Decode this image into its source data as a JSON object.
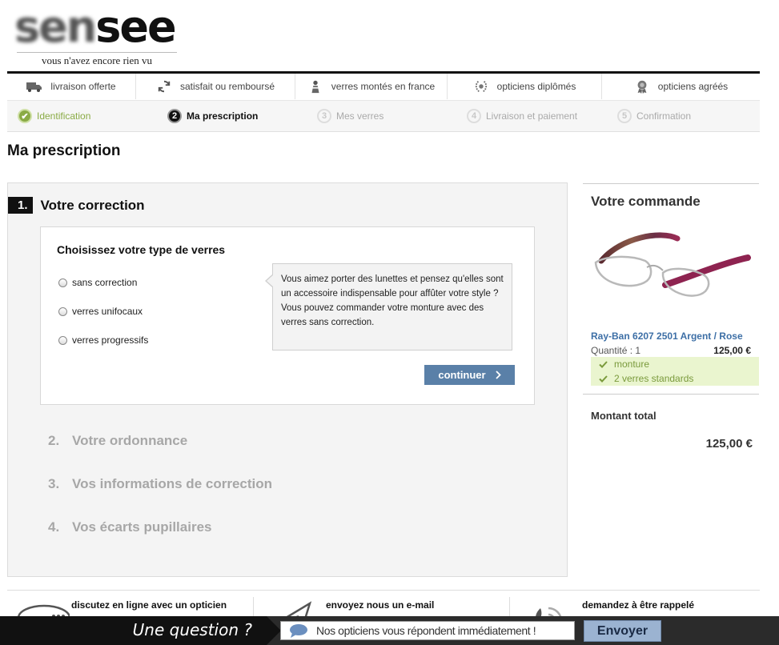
{
  "header": {
    "logo_prefix": "sen",
    "logo_suffix": "see",
    "tagline": "vous n'avez encore rien vu"
  },
  "benefits": [
    {
      "label": "livraison offerte",
      "icon": "truck-icon"
    },
    {
      "label": "satisfait ou remboursé",
      "icon": "refresh-icon"
    },
    {
      "label": "verres montés en france",
      "icon": "worker-icon"
    },
    {
      "label": "opticiens diplômés",
      "icon": "laurel-icon"
    },
    {
      "label": "opticiens agréés",
      "icon": "medal-icon"
    }
  ],
  "steps": [
    {
      "num": "✔",
      "label": "Identification",
      "state": "done"
    },
    {
      "num": "2",
      "label": "Ma prescription",
      "state": "active"
    },
    {
      "num": "3",
      "label": "Mes verres",
      "state": "todo"
    },
    {
      "num": "4",
      "label": "Livraison et paiement",
      "state": "todo"
    },
    {
      "num": "5",
      "label": "Confirmation",
      "state": "todo"
    }
  ],
  "page_title": "Ma prescription",
  "section1": {
    "num": "1.",
    "title": "Votre correction",
    "box_title": "Choisissez votre type de verres",
    "options": [
      "sans correction",
      "verres unifocaux",
      "verres progressifs"
    ],
    "tooltip": "Vous aimez porter des lunettes et pensez qu'elles sont un accessoire indispensable pour affûter votre style ? Vous pouvez commander votre monture avec des verres sans correction.",
    "continue_label": "continuer"
  },
  "other_sections": [
    {
      "num": "2.",
      "title": "Votre ordonnance"
    },
    {
      "num": "3.",
      "title": "Vos informations de correction"
    },
    {
      "num": "4.",
      "title": "Vos écarts pupillaires"
    }
  ],
  "order": {
    "title": "Votre commande",
    "product_name": "Ray-Ban 6207 2501 Argent / Rose",
    "quantity_label": "Quantité : 1",
    "price": "125,00 €",
    "features": [
      "monture",
      "2 verres standards"
    ],
    "total_label": "Montant total",
    "total_value": "125,00 €"
  },
  "footer_contact": [
    {
      "title": "discutez en ligne avec un opticien"
    },
    {
      "title": "envoyez nous un e-mail"
    },
    {
      "title": "demandez à être rappelé"
    }
  ],
  "chat": {
    "question": "Une question ?",
    "prompt": "Nos opticiens vous répondent immédiatement !",
    "send_label": "Envoyer"
  },
  "colors": {
    "accent_blue": "#5a80a8",
    "done_green": "#8aab45",
    "feature_bg": "#eaf5cf",
    "product_link": "#3d6fa6"
  }
}
